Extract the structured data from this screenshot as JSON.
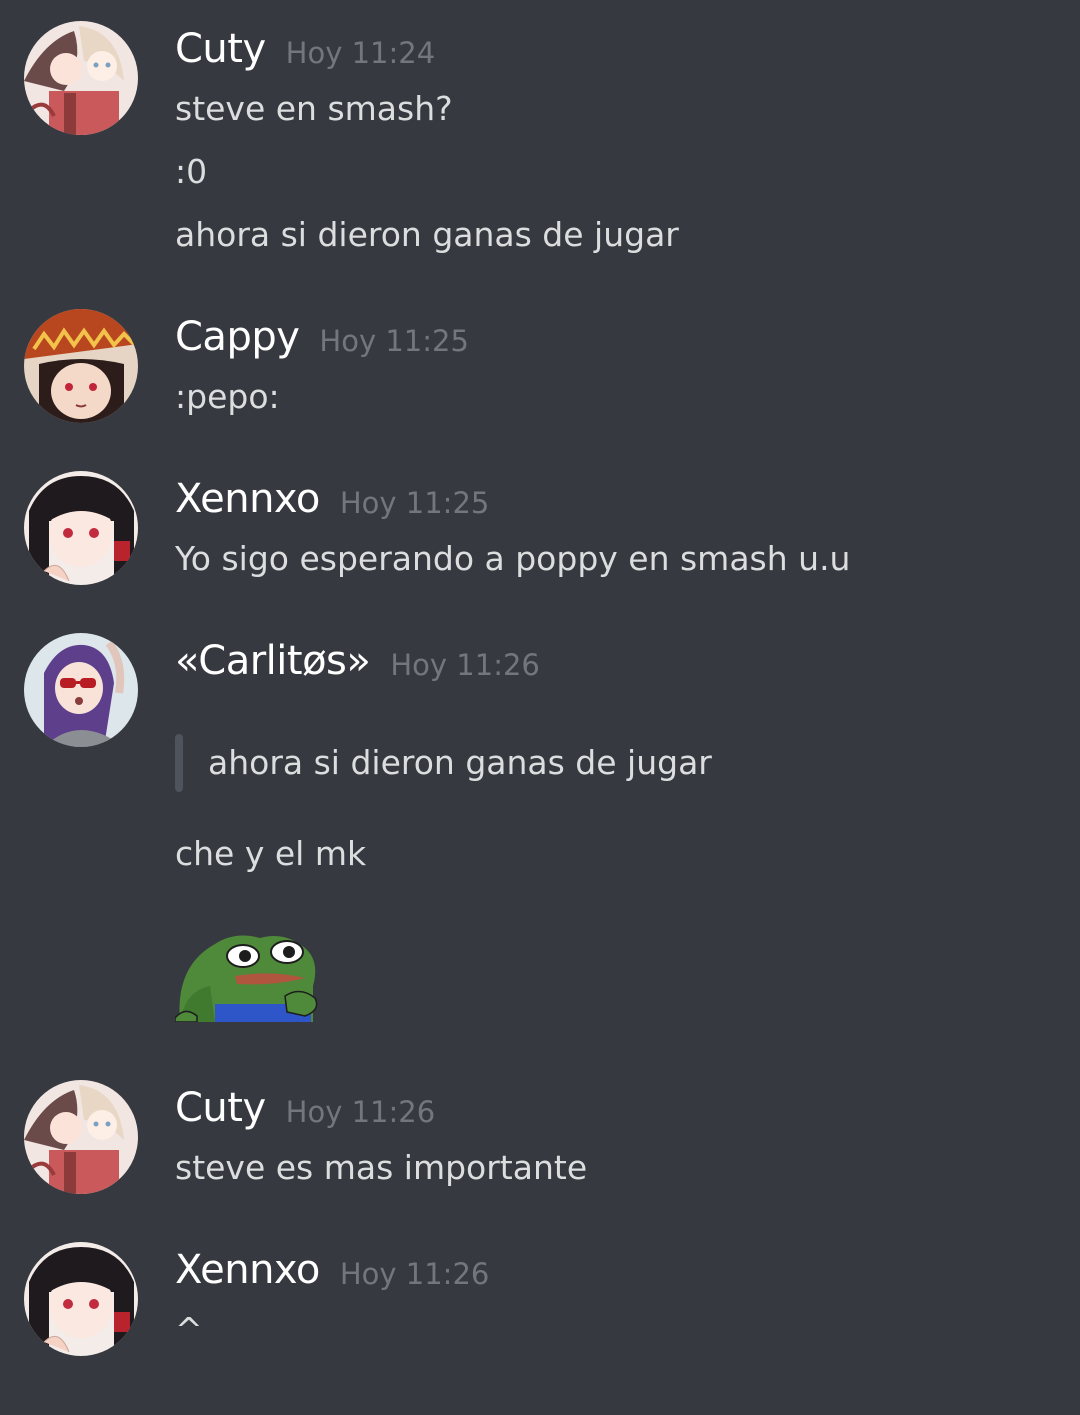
{
  "messages": [
    {
      "username": "Cuty",
      "timestamp": "Hoy 11:24",
      "avatar": "anime-girls-avatar",
      "lines": [
        "steve en smash?",
        ":0",
        "ahora si dieron ganas de jugar"
      ]
    },
    {
      "username": "Cappy",
      "timestamp": "Hoy 11:25",
      "avatar": "megumin-hat-avatar",
      "lines": [
        ":pepo:"
      ]
    },
    {
      "username": "Xennxo",
      "timestamp": "Hoy 11:25",
      "avatar": "kaguya-avatar",
      "lines": [
        "Yo sigo esperando a poppy en smash u.u"
      ]
    },
    {
      "username": "«Carlitøs»",
      "timestamp": "Hoy 11:26",
      "avatar": "sunglasses-girl-avatar",
      "quote": "ahora si dieron ganas de jugar",
      "lines": [
        "che y el mk"
      ],
      "emoji": "pepe-emoji"
    },
    {
      "username": "Cuty",
      "timestamp": "Hoy 11:26",
      "avatar": "anime-girls-avatar",
      "lines": [
        "steve es mas importante"
      ]
    },
    {
      "username": "Xennxo",
      "timestamp": "Hoy 11:26",
      "avatar": "kaguya-avatar",
      "lines": [
        "^"
      ]
    }
  ],
  "colors": {
    "background": "#36393f",
    "username": "#ffffff",
    "timestamp": "#72767d",
    "message_text": "#dcddde",
    "quote_bar": "#4f545c"
  }
}
